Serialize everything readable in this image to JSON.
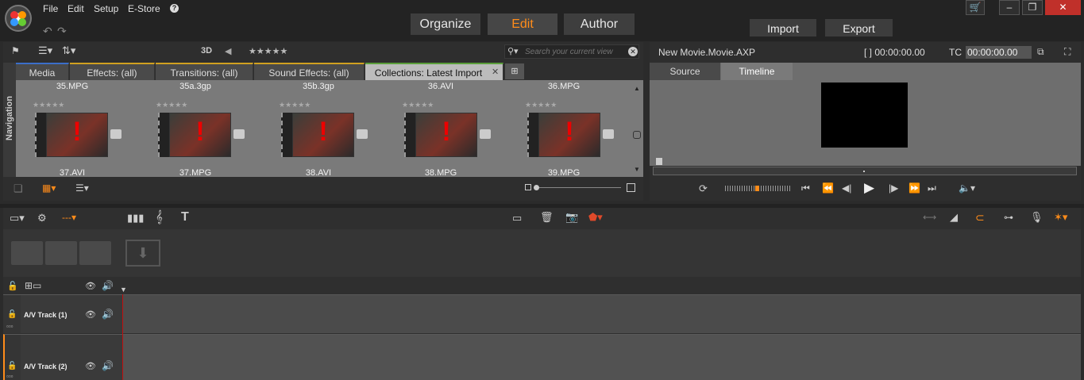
{
  "menu": {
    "file": "File",
    "edit": "Edit",
    "setup": "Setup",
    "estore": "E-Store"
  },
  "modes": {
    "organize": "Organize",
    "edit": "Edit",
    "author": "Author"
  },
  "actions": {
    "import": "Import",
    "export": "Export"
  },
  "library": {
    "view3d": "3D",
    "search_placeholder": "Search your current view",
    "navigation_label": "Navigation",
    "tabs": [
      {
        "label": "Media"
      },
      {
        "label": "Effects: (all)"
      },
      {
        "label": "Transitions: (all)"
      },
      {
        "label": "Sound Effects: (all)"
      },
      {
        "label": "Collections: Latest Import"
      }
    ],
    "top_names": [
      "35.MPG",
      "35a.3gp",
      "35b.3gp",
      "36.AVI",
      "36.MPG"
    ],
    "bottom_names": [
      "37.AVI",
      "37.MPG",
      "38.AVI",
      "38.MPG",
      "39.MPG"
    ],
    "stars": "★★★★★"
  },
  "player": {
    "title": "New Movie.Movie.AXP",
    "bracket_tc": "[ ] 00:00:00.00",
    "tc_label": "TC",
    "tc_value": "00:00:00.00",
    "tabs": {
      "source": "Source",
      "timeline": "Timeline"
    }
  },
  "timeline": {
    "tracks": [
      {
        "label": "A/V Track (1)"
      },
      {
        "label": "A/V Track (2)"
      }
    ]
  },
  "colors": {
    "accent": "#ff8c1a",
    "playhead": "#c01010"
  }
}
